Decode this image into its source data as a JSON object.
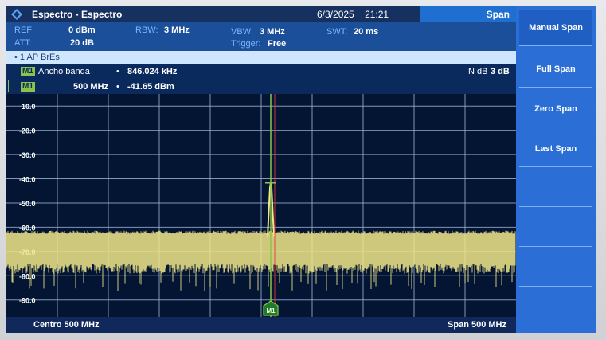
{
  "header": {
    "app_title": "Espectro - Espectro",
    "date": "6/3/2025",
    "time": "21:21",
    "mode": "Span"
  },
  "settings": {
    "ref_label": "REF:",
    "ref_value": "0 dBm",
    "att_label": "ATT:",
    "att_value": "20 dB",
    "rbw_label": "RBW:",
    "rbw_value": "3 MHz",
    "vbw_label": "VBW:",
    "vbw_value": "3 MHz",
    "trigger_label": "Trigger:",
    "trigger_value": "Free",
    "swt_label": "SWT:",
    "swt_value": "20 ms"
  },
  "trace": {
    "label": "• 1 AP  BrEs"
  },
  "markers": {
    "bandwidth_tag": "M1",
    "bandwidth_label": "Ancho banda",
    "bandwidth_bullet": "•",
    "bandwidth_value": "846.024 kHz",
    "ndb_label": "N dB",
    "ndb_value": "3 dB",
    "m1_tag": "M1",
    "m1_freq": "500 MHz",
    "m1_bullet": "•",
    "m1_level": "-41.65 dBm",
    "plot_marker_label": "M1"
  },
  "plot": {
    "y_ticks": [
      "-10.0",
      "-20.0",
      "-30.0",
      "-40.0",
      "-50.0",
      "-60.0",
      "-70.0",
      "-80.0",
      "-90.0"
    ],
    "y_tick_values": [
      -10,
      -20,
      -30,
      -40,
      -50,
      -60,
      -70,
      -80,
      -90
    ],
    "y_top_db": -5,
    "y_bottom_db": -97,
    "noise_floor_db": -64,
    "noise_floor_min_db": -76,
    "peak_db": -41.65,
    "v_divisions": 10,
    "grid_color": "#9fb6d8",
    "trace_color": "#f2e88a",
    "marker_line_color": "#8bc34a",
    "center_line_color": "#e53935"
  },
  "status": {
    "center": "Centro 500 MHz",
    "span": "Span 500 MHz"
  },
  "softkeys": [
    "Manual Span",
    "Full Span",
    "Zero Span",
    "Last Span",
    "",
    "",
    "",
    ""
  ]
}
